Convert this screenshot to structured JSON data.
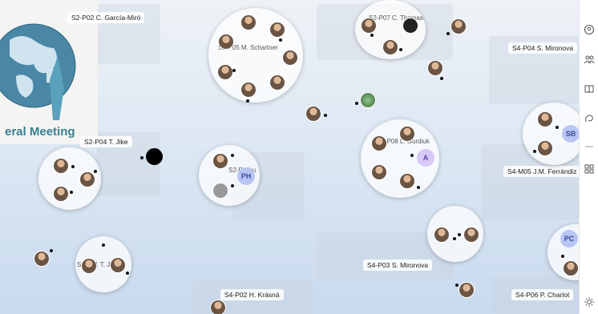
{
  "logo": {
    "text": "eral Meeting"
  },
  "rooms": {
    "s2_p02": "S2-P02 C. García-Miró",
    "s2_p05": "S2-P05 M. Schartner",
    "s2_p07": "S2-P07 C. Thomas",
    "s4_p04_top": "S4-P04 S. Mironova",
    "s2_p04": "S2-P04 T. Jike",
    "s2_p_shu": "S2-P Shu",
    "s2_p08": "S2-P08 L. Gurdiuk",
    "s4_m05": "S4-M05 J.M. Ferrándiz",
    "s4_p03": "S4-P03 S. Mironova",
    "s2_p01": "S2-P01 T. Jason",
    "s4_p02": "S4-P02 H. Krásná",
    "s4_p06": "S4-P06 P. Charlot"
  },
  "initials": {
    "ph": "PH",
    "a": "A",
    "sb": "SB",
    "pc": "PC"
  },
  "icons": [
    "account-icon",
    "people-icon",
    "book-icon",
    "sign-icon",
    "grid-icon",
    "sun-icon"
  ],
  "colors": {
    "initials_blue": "#b9c6f5",
    "initials_purple": "#d7c8f7",
    "logo_teal": "#3b7f92"
  }
}
